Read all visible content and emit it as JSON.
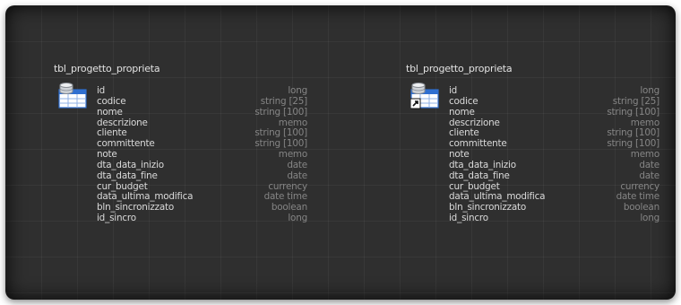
{
  "colors": {
    "canvas": "#2f2f2f",
    "title_text": "#e2e2e2",
    "field_text": "#dadada",
    "type_text": "#858585",
    "icon_blue": "#2f6fd0"
  },
  "tables": [
    {
      "title": "tbl_progetto_proprieta",
      "icon": "database-table-icon",
      "linked": false,
      "fields": [
        {
          "name": "id",
          "type": "long"
        },
        {
          "name": "codice",
          "type": "string [25]"
        },
        {
          "name": "nome",
          "type": "string [100]"
        },
        {
          "name": "descrizione",
          "type": "memo"
        },
        {
          "name": "cliente",
          "type": "string [100]"
        },
        {
          "name": "committente",
          "type": "string [100]"
        },
        {
          "name": "note",
          "type": "memo"
        },
        {
          "name": "dta_data_inizio",
          "type": "date"
        },
        {
          "name": "dta_data_fine",
          "type": "date"
        },
        {
          "name": "cur_budget",
          "type": "currency"
        },
        {
          "name": "data_ultima_modifica",
          "type": "date time"
        },
        {
          "name": "bln_sincronizzato",
          "type": "boolean"
        },
        {
          "name": "id_sincro",
          "type": "long"
        }
      ]
    },
    {
      "title": "tbl_progetto_proprieta",
      "icon": "linked-database-table-icon",
      "linked": true,
      "fields": [
        {
          "name": "id",
          "type": "long"
        },
        {
          "name": "codice",
          "type": "string [25]"
        },
        {
          "name": "nome",
          "type": "string [100]"
        },
        {
          "name": "descrizione",
          "type": "memo"
        },
        {
          "name": "cliente",
          "type": "string [100]"
        },
        {
          "name": "committente",
          "type": "string [100]"
        },
        {
          "name": "note",
          "type": "memo"
        },
        {
          "name": "dta_data_inizio",
          "type": "date"
        },
        {
          "name": "dta_data_fine",
          "type": "date"
        },
        {
          "name": "cur_budget",
          "type": "currency"
        },
        {
          "name": "data_ultima_modifica",
          "type": "date time"
        },
        {
          "name": "bln_sincronizzato",
          "type": "boolean"
        },
        {
          "name": "id_sincro",
          "type": "long"
        }
      ]
    }
  ]
}
